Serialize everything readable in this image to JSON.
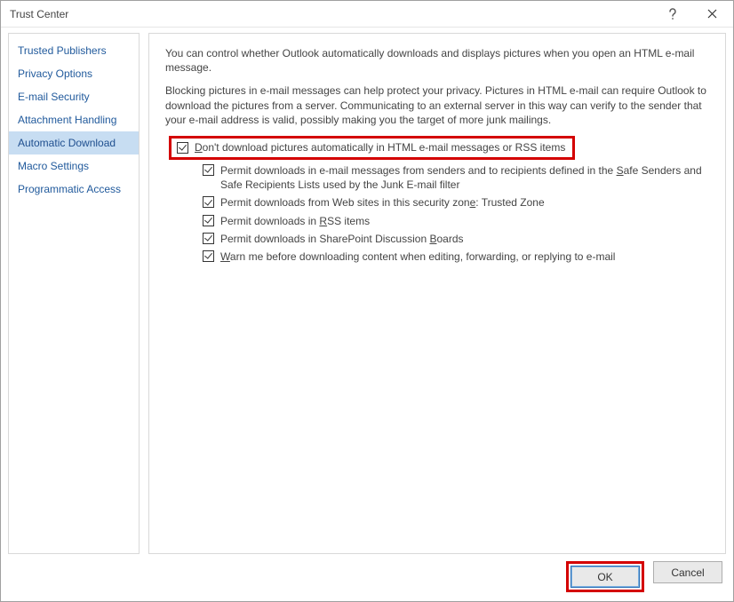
{
  "window": {
    "title": "Trust Center"
  },
  "sidebar": {
    "items": [
      {
        "label": "Trusted Publishers"
      },
      {
        "label": "Privacy Options"
      },
      {
        "label": "E-mail Security"
      },
      {
        "label": "Attachment Handling"
      },
      {
        "label": "Automatic Download"
      },
      {
        "label": "Macro Settings"
      },
      {
        "label": "Programmatic Access"
      }
    ],
    "active_index": 4
  },
  "content": {
    "para1": "You can control whether Outlook automatically downloads and displays pictures when you open an HTML e-mail message.",
    "para2": "Blocking pictures in e-mail messages can help protect your privacy. Pictures in HTML e-mail can require Outlook to download the pictures from a server. Communicating to an external server in this way can verify to the sender that your e-mail address is valid, possibly making you the target of more junk mailings.",
    "main_option": {
      "checked": true,
      "pre": "",
      "u": "D",
      "post": "on't download pictures automatically in HTML e-mail messages or RSS items"
    },
    "sub_options": [
      {
        "checked": true,
        "segments": [
          "Permit downloads in e-mail messages from senders and to recipients defined in the ",
          {
            "u": "S"
          },
          "afe Senders and Safe Recipients Lists used by the Junk E-mail filter"
        ]
      },
      {
        "checked": true,
        "segments": [
          "Permit downloads from Web sites in this security zon",
          {
            "u": "e"
          },
          ": Trusted Zone"
        ]
      },
      {
        "checked": true,
        "segments": [
          "Permit downloads in ",
          {
            "u": "R"
          },
          "SS items"
        ]
      },
      {
        "checked": true,
        "segments": [
          "Permit downloads in SharePoint Discussion ",
          {
            "u": "B"
          },
          "oards"
        ]
      },
      {
        "checked": true,
        "segments": [
          {
            "u": "W"
          },
          "arn me before downloading content when editing, forwarding, or replying to e-mail"
        ]
      }
    ]
  },
  "footer": {
    "ok": "OK",
    "cancel": "Cancel"
  }
}
